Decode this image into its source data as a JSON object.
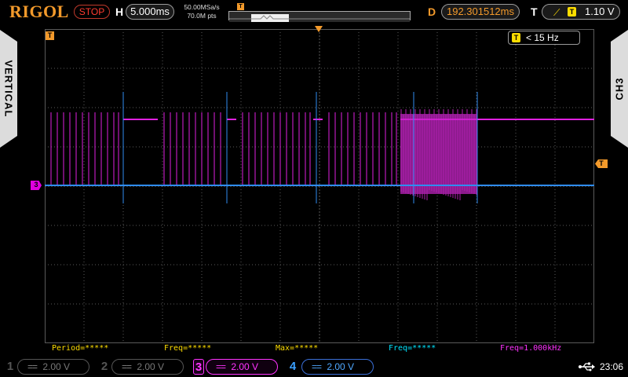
{
  "header": {
    "brand": "RIGOL",
    "run_state": "STOP",
    "horizontal_label": "H",
    "timebase": "5.000ms",
    "sample_rate": "50.00MSa/s",
    "memory_depth": "70.0M pts",
    "delay_label": "D",
    "delay_value": "192.301512ms",
    "trigger_label": "T",
    "trigger_source": "T",
    "trigger_level": "1.10 V",
    "trigger_edge_icon": "rising-edge-icon",
    "memory_marker": "T"
  },
  "side": {
    "left_label": "VERTICAL",
    "right_label": "CH3"
  },
  "screen": {
    "trigger_info_source": "T",
    "trigger_info_text": "< 15 Hz",
    "trig_marker_top": "T",
    "trig_marker_right": "T",
    "ch3_marker": "3"
  },
  "measurements": [
    {
      "text": "Period=*****",
      "color": "#ffde00"
    },
    {
      "text": "Freq=*****",
      "color": "#ffde00"
    },
    {
      "text": "Max=*****",
      "color": "#ffde00"
    },
    {
      "text": "Freq=*****",
      "color": "#00e5ff"
    },
    {
      "text": "Freq=1.000kHz",
      "color": "#ff33ff"
    }
  ],
  "channels": [
    {
      "num": "1",
      "coupling_icon": "dc-coupling-icon",
      "coupling": "==",
      "scale": "2.00 V",
      "enabled": false
    },
    {
      "num": "2",
      "coupling_icon": "dc-coupling-icon",
      "coupling": "==",
      "scale": "2.00 V",
      "enabled": false
    },
    {
      "num": "3",
      "coupling_icon": "dc-coupling-icon",
      "coupling": "==",
      "scale": "2.00 V",
      "enabled": true,
      "color": "#ff33ff"
    },
    {
      "num": "4",
      "coupling_icon": "dc-coupling-icon",
      "coupling": "==",
      "scale": "2.00 V",
      "enabled": true,
      "color": "#3aa0ff"
    }
  ],
  "status": {
    "usb_icon": "usb-icon",
    "time": "23:06"
  },
  "colors": {
    "ch3": "#e020e0",
    "ch4": "#2f8cf0",
    "trigger": "#f39a2b",
    "grid": "#5a5a5a"
  }
}
